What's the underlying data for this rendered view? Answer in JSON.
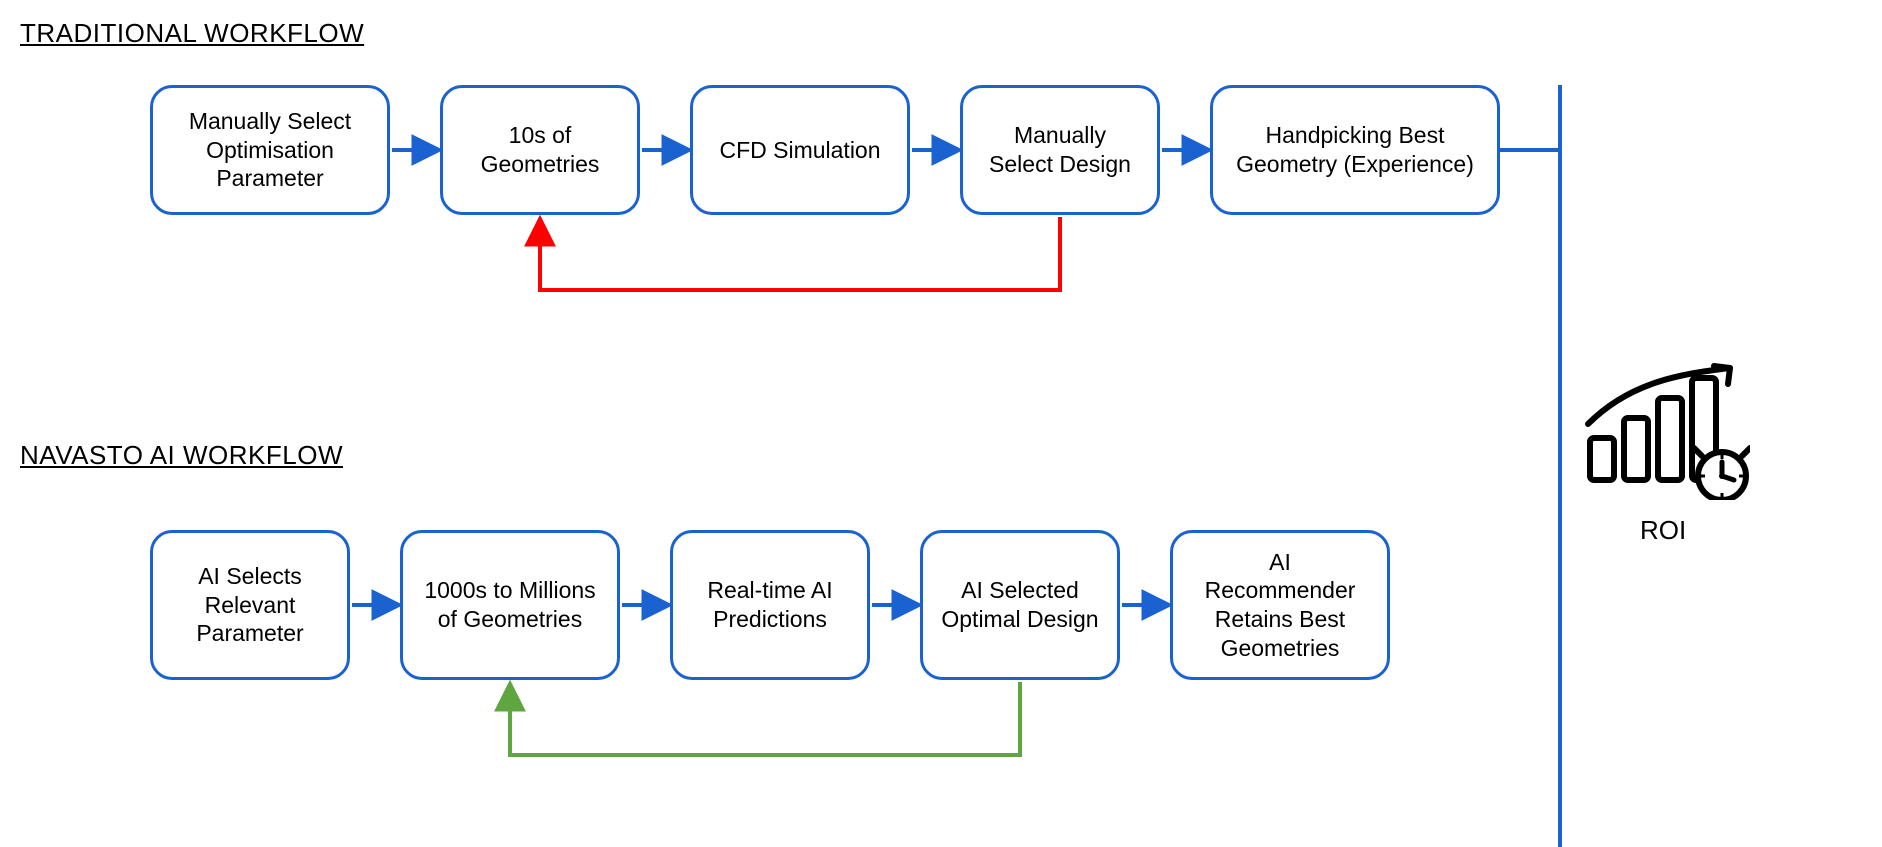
{
  "titles": {
    "traditional": "TRADITIONAL WORKFLOW",
    "ai": "NAVASTO AI WORKFLOW"
  },
  "traditional": {
    "step1": "Manually Select Optimisation Parameter",
    "step2": "10s of Geometries",
    "step3": "CFD Simulation",
    "step4": "Manually Select Design",
    "step5": "Handpicking Best Geometry (Experience)"
  },
  "ai": {
    "step1": "AI Selects Relevant Parameter",
    "step2": "1000s to Millions of Geometries",
    "step3": "Real-time AI Predictions",
    "step4": "AI Selected Optimal Design",
    "step5": "AI Recommender Retains Best Geometries"
  },
  "roi": {
    "label": "ROI"
  },
  "colors": {
    "blue": "#1b62d1",
    "red": "#ff0000",
    "green": "#5fa641"
  }
}
